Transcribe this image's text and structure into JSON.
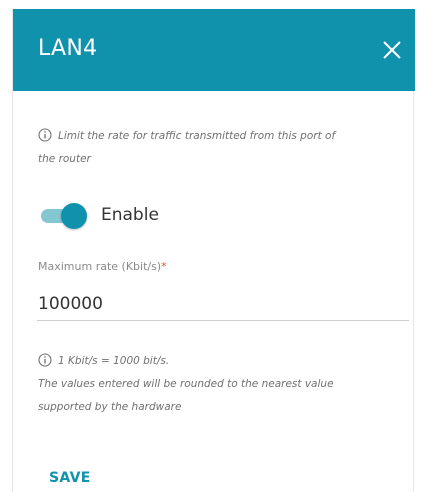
{
  "dialog": {
    "title": "LAN4",
    "close_icon": "close-icon"
  },
  "description": {
    "icon": "info-icon",
    "line1": "Limit the rate for traffic transmitted from this port of",
    "line2": "the router"
  },
  "enable_toggle": {
    "label": "Enable",
    "state": "on"
  },
  "max_rate": {
    "label": "Maximum rate (Kbit/s)",
    "required_mark": "*",
    "value": "100000"
  },
  "hint": {
    "icon": "info-icon",
    "line1": "1 Kbit/s = 1000 bit/s.",
    "line2": "The values entered will be rounded to the nearest value",
    "line3": "supported by the hardware"
  },
  "actions": {
    "save_label": "SAVE"
  },
  "colors": {
    "accent": "#1192ac",
    "required": "#e2502d"
  }
}
